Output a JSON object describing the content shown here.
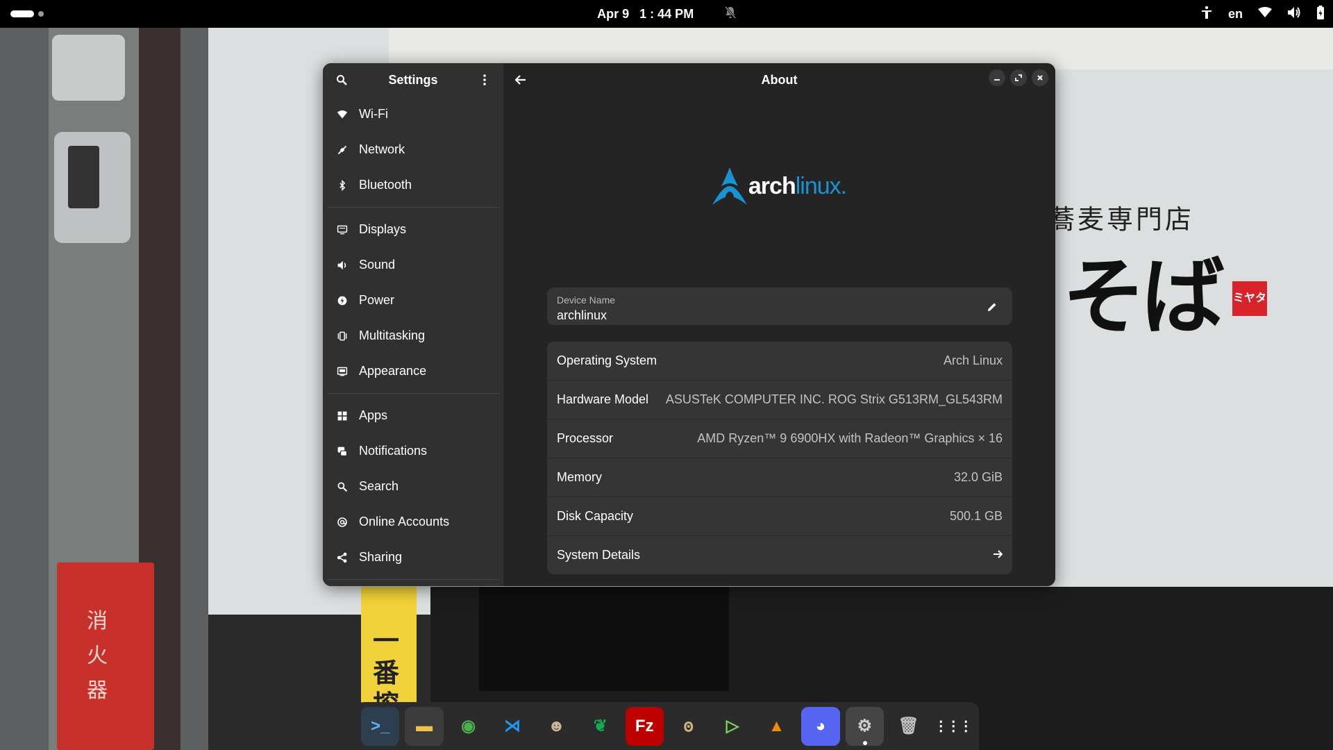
{
  "topbar": {
    "date": "Apr 9",
    "time": "1 : 44 PM",
    "language": "en",
    "icons": [
      "activities-indicator",
      "notifications-muted-icon",
      "accessibility-icon",
      "wifi-icon",
      "volume-icon",
      "battery-icon"
    ]
  },
  "wallpaper_text": {
    "fire_box": "消火器",
    "sign": "一番搾",
    "shop_small": "蕎麦専門店",
    "shop_large": "そば",
    "stamp": "ミヤタ",
    "top_mark": "ば"
  },
  "settings": {
    "sidebar_title": "Settings",
    "sidebar_groups": [
      [
        {
          "label": "Wi-Fi",
          "icon": "wifi-icon"
        },
        {
          "label": "Network",
          "icon": "network-icon"
        },
        {
          "label": "Bluetooth",
          "icon": "bluetooth-icon"
        }
      ],
      [
        {
          "label": "Displays",
          "icon": "display-icon"
        },
        {
          "label": "Sound",
          "icon": "sound-icon"
        },
        {
          "label": "Power",
          "icon": "power-icon"
        },
        {
          "label": "Multitasking",
          "icon": "multitasking-icon"
        },
        {
          "label": "Appearance",
          "icon": "appearance-icon"
        }
      ],
      [
        {
          "label": "Apps",
          "icon": "apps-icon"
        },
        {
          "label": "Notifications",
          "icon": "notifications-icon"
        },
        {
          "label": "Search",
          "icon": "search-icon"
        },
        {
          "label": "Online Accounts",
          "icon": "online-accounts-icon"
        },
        {
          "label": "Sharing",
          "icon": "sharing-icon"
        }
      ]
    ],
    "page_title": "About",
    "logo": {
      "arch": "arch",
      "linux": "linux",
      "dot": "."
    },
    "device": {
      "label": "Device Name",
      "value": "archlinux"
    },
    "info_rows": [
      {
        "key": "Operating System",
        "value": "Arch Linux"
      },
      {
        "key": "Hardware Model",
        "value": "ASUSTeK COMPUTER INC. ROG Strix G513RM_GL543RM"
      },
      {
        "key": "Processor",
        "value": "AMD Ryzen™ 9 6900HX with Radeon™ Graphics × 16"
      },
      {
        "key": "Memory",
        "value": "32.0 GiB"
      },
      {
        "key": "Disk Capacity",
        "value": "500.1 GB"
      }
    ],
    "details_row": {
      "key": "System Details"
    },
    "colors": {
      "arch_blue": "#1793d1",
      "window_bg": "#242424",
      "sidebar_bg": "#303030",
      "card_bg": "#353535"
    }
  },
  "dock": {
    "apps": [
      {
        "name": "terminal",
        "glyph": ">_",
        "bg": "#2d3e4e",
        "fg": "#5fb3f5"
      },
      {
        "name": "files",
        "glyph": "▬",
        "bg": "#3c3c3c",
        "fg": "#f0c14b"
      },
      {
        "name": "chrome",
        "glyph": "◉",
        "bg": "#2b2b2b",
        "fg": "#4caf50"
      },
      {
        "name": "vscode",
        "glyph": "⋊",
        "bg": "#2b2b2b",
        "fg": "#2196f3"
      },
      {
        "name": "dbeaver",
        "glyph": "☻",
        "bg": "#2b2b2b",
        "fg": "#c8b49a"
      },
      {
        "name": "mongodb-compass",
        "glyph": "❦",
        "bg": "#2b2b2b",
        "fg": "#13aa52"
      },
      {
        "name": "filezilla",
        "glyph": "Fz",
        "bg": "#bf0000",
        "fg": "#ffffff"
      },
      {
        "name": "gimp",
        "glyph": "ꙩ",
        "bg": "#2b2b2b",
        "fg": "#c9b77a"
      },
      {
        "name": "player",
        "glyph": "▷",
        "bg": "#2b2b2b",
        "fg": "#7ed957"
      },
      {
        "name": "vlc",
        "glyph": "▲",
        "bg": "#2b2b2b",
        "fg": "#f08c00"
      },
      {
        "name": "discord",
        "glyph": "◕",
        "bg": "#5865f2",
        "fg": "#ffffff"
      },
      {
        "name": "settings",
        "glyph": "⚙",
        "bg": "#454545",
        "fg": "#cfcfcf",
        "active": true
      },
      {
        "name": "trash",
        "glyph": "🗑",
        "bg": "#2b2b2b",
        "fg": "#bfbfbf"
      },
      {
        "name": "app-grid",
        "glyph": "⋮⋮⋮",
        "bg": "#2b2b2b",
        "fg": "#ffffff"
      }
    ]
  }
}
